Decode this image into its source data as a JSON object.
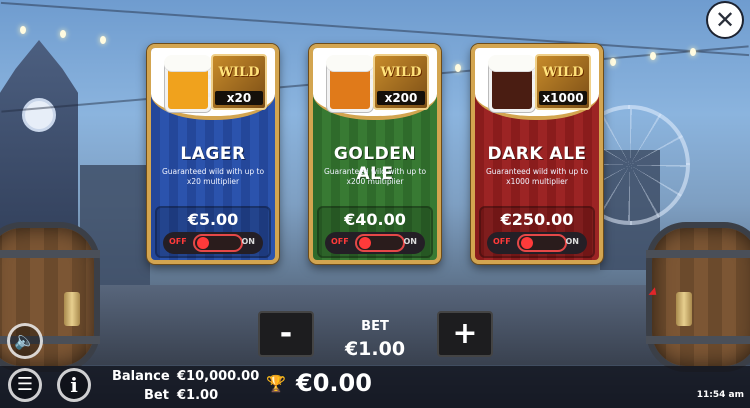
{
  "close_icon": "close-icon",
  "cards": [
    {
      "name": "LAGER",
      "wild_word": "WILD",
      "multiplier": "x20",
      "description": "Guaranteed wild with up to x20 multiplier",
      "price": "€5.00",
      "toggle_off": "OFF",
      "toggle_on": "ON",
      "beer_color": "#f0a21d",
      "card_color": "#24479a"
    },
    {
      "name": "GOLDEN ALE",
      "wild_word": "WILD",
      "multiplier": "x200",
      "description": "Guaranteed wild with up to x200 multiplier",
      "price": "€40.00",
      "toggle_off": "OFF",
      "toggle_on": "ON",
      "beer_color": "#e07a1a",
      "card_color": "#2f6b2b"
    },
    {
      "name": "DARK ALE",
      "wild_word": "WILD",
      "multiplier": "x1000",
      "description": "Guaranteed wild with up to x1000 multiplier",
      "price": "€250.00",
      "toggle_off": "OFF",
      "toggle_on": "ON",
      "beer_color": "#4a1d12",
      "card_color": "#8a1c1c"
    }
  ],
  "bet": {
    "label": "BET",
    "value": "€1.00",
    "minus": "-",
    "plus": "+"
  },
  "footer": {
    "balance_label": "Balance",
    "balance_value": "€10,000.00",
    "bet_label": "Bet",
    "bet_value": "€1.00",
    "win_value": "€0.00",
    "time": "11:54 am"
  }
}
